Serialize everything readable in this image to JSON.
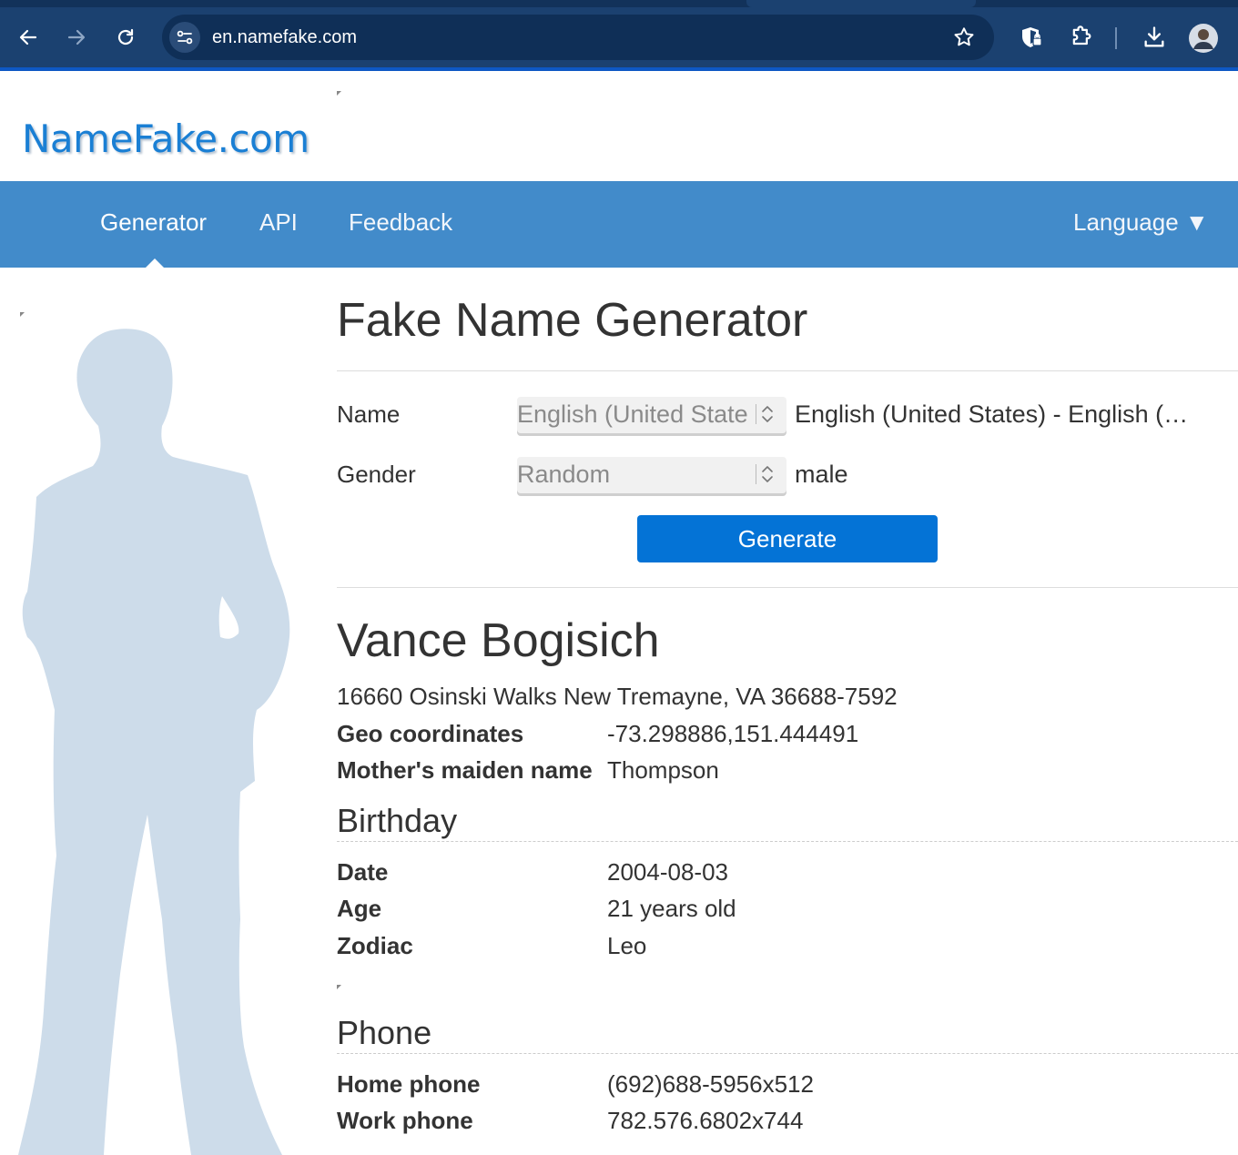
{
  "browser": {
    "url": "en.namefake.com"
  },
  "site": {
    "logo": "NameFake.com"
  },
  "nav": {
    "items": [
      {
        "label": "Generator"
      },
      {
        "label": "API"
      },
      {
        "label": "Feedback"
      }
    ],
    "language_label": "Language ▼"
  },
  "form": {
    "title": "Fake Name Generator",
    "name_label": "Name",
    "name_select_value": "English (United State",
    "name_selected_text": "English (United States) - English (…",
    "gender_label": "Gender",
    "gender_select_value": "Random",
    "gender_selected_text": "male",
    "generate_label": "Generate"
  },
  "result": {
    "name": "Vance Bogisich",
    "address": "16660 Osinski Walks New Tremayne, VA 36688-7592",
    "fields": [
      {
        "label": "Geo coordinates",
        "value": "-73.298886,151.444491"
      },
      {
        "label": "Mother's maiden name",
        "value": "Thompson"
      }
    ],
    "birthday": {
      "heading": "Birthday",
      "fields": [
        {
          "label": "Date",
          "value": "2004-08-03"
        },
        {
          "label": "Age",
          "value": "21 years old"
        },
        {
          "label": "Zodiac",
          "value": "Leo"
        }
      ]
    },
    "phone": {
      "heading": "Phone",
      "fields": [
        {
          "label": "Home phone",
          "value": "(692)688-5956x512"
        },
        {
          "label": "Work phone",
          "value": "782.576.6802x744"
        }
      ]
    }
  },
  "colors": {
    "chrome_bg": "#1b4170",
    "navbar_bg": "#428bca",
    "button_bg": "#0473d6",
    "logo": "#1a7fd4",
    "silhouette": "#cddcea"
  }
}
